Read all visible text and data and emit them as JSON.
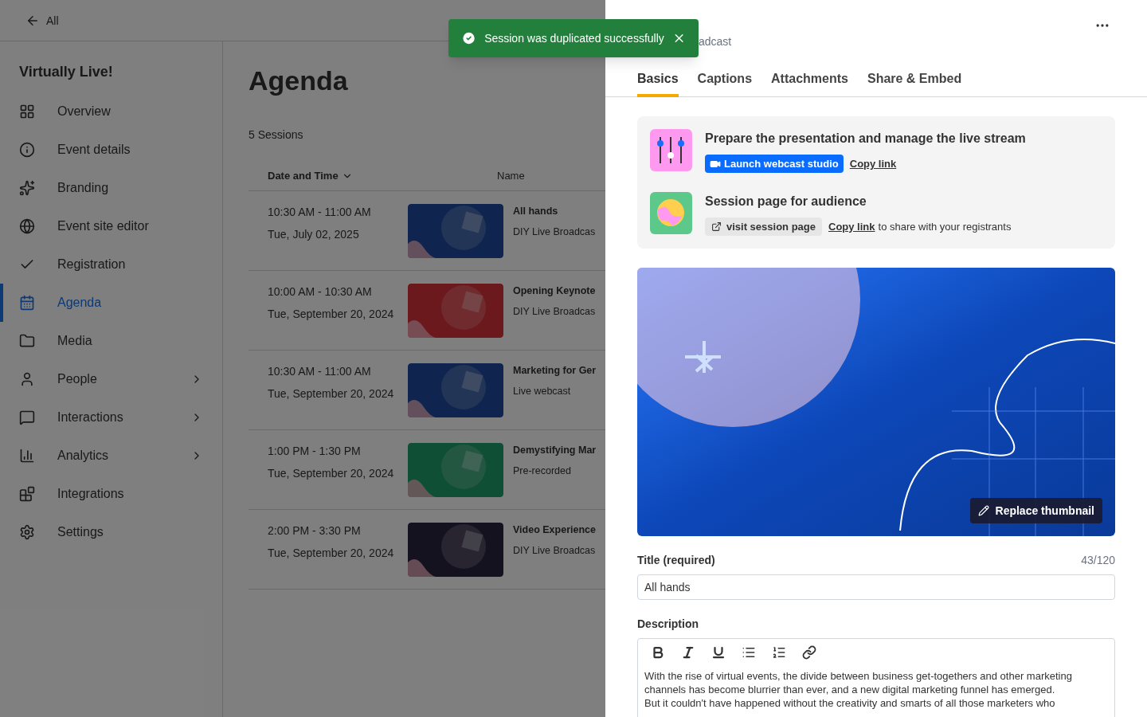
{
  "top_bar": {
    "back_label": "All"
  },
  "sidebar": {
    "title": "Virtually Live!",
    "items": [
      {
        "label": "Overview",
        "selected": false,
        "has_submenu": false
      },
      {
        "label": "Event details",
        "selected": false,
        "has_submenu": false
      },
      {
        "label": "Branding",
        "selected": false,
        "has_submenu": false
      },
      {
        "label": "Event site editor",
        "selected": false,
        "has_submenu": false
      },
      {
        "label": "Registration",
        "selected": false,
        "has_submenu": false
      },
      {
        "label": "Agenda",
        "selected": true,
        "has_submenu": false
      },
      {
        "label": "Media",
        "selected": false,
        "has_submenu": false
      },
      {
        "label": "People",
        "selected": false,
        "has_submenu": true
      },
      {
        "label": "Interactions",
        "selected": false,
        "has_submenu": true
      },
      {
        "label": "Analytics",
        "selected": false,
        "has_submenu": true
      },
      {
        "label": "Integrations",
        "selected": false,
        "has_submenu": false
      },
      {
        "label": "Settings",
        "selected": false,
        "has_submenu": false
      }
    ]
  },
  "agenda": {
    "title": "Agenda",
    "count": "5 Sessions",
    "columns": [
      "Date and Time",
      "Name"
    ],
    "sessions": [
      {
        "time": "10:30 AM - 11:00 AM",
        "date": "Tue, July 02, 2025",
        "name": "All hands",
        "type": "DIY Live Broadcas"
      },
      {
        "time": "10:00 AM - 10:30 AM",
        "date": "Tue, September 20, 2024",
        "name": "Opening Keynote",
        "type": "DIY Live Broadcas"
      },
      {
        "time": "10:30 AM - 11:00 AM",
        "date": "Tue, September 20, 2024",
        "name": "Marketing for Ger",
        "type": "Live webcast"
      },
      {
        "time": "1:00 PM - 1:30 PM",
        "date": "Tue, September 20, 2024",
        "name": "Demystifying Mar",
        "type": "Pre-recorded"
      },
      {
        "time": "2:00 PM - 3:30 PM",
        "date": "Tue, September 20, 2024",
        "name": "Video Experience",
        "type": "DIY Live Broadcas"
      }
    ]
  },
  "toast": {
    "message": "Session was duplicated successfully"
  },
  "drawer": {
    "subtitle": "adcast",
    "tabs": [
      {
        "label": "Basics",
        "selected": true
      },
      {
        "label": "Captions",
        "selected": false
      },
      {
        "label": "Attachments",
        "selected": false
      },
      {
        "label": "Share & Embed",
        "selected": false
      }
    ],
    "studio": {
      "heading": "Prepare the presentation and manage the live stream",
      "launch": "Launch webcast studio",
      "copy": "Copy link"
    },
    "audience": {
      "heading": "Session page for audience",
      "visit": "visit session page",
      "copy": "Copy link",
      "suffix": "to share with your registrants"
    },
    "replace": "Replace thumbnail",
    "title_label": "Title (required)",
    "title_count": "43/120",
    "title_value": "All hands",
    "description_label": "Description",
    "description": "With the rise of virtual events, the divide between business get-togethers and other marketing channels has become blurrier than ever, and a new digital marketing funnel has emerged.\nBut it couldn't have happened without the creativity and smarts of all those marketers who"
  }
}
